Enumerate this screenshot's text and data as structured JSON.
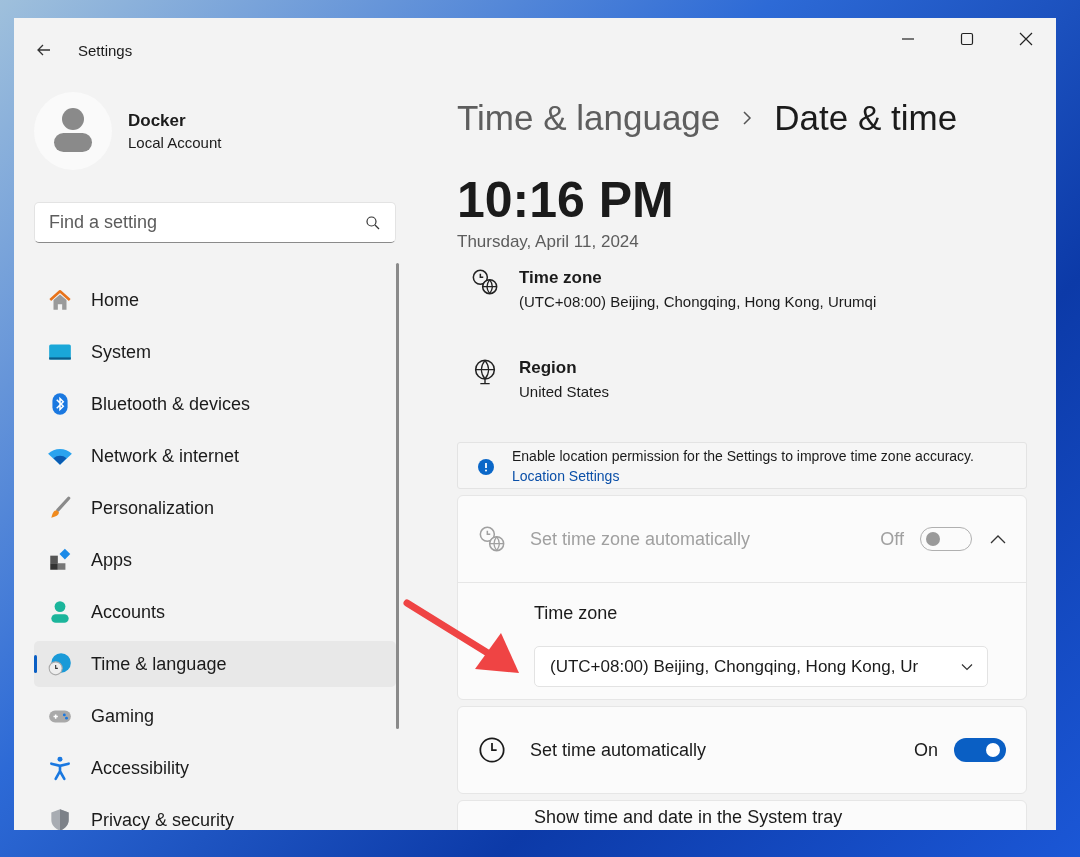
{
  "window": {
    "title": "Settings"
  },
  "account": {
    "name": "Docker",
    "type": "Local Account"
  },
  "search": {
    "placeholder": "Find a setting"
  },
  "sidebar": {
    "items": [
      {
        "label": "Home",
        "selected": false
      },
      {
        "label": "System",
        "selected": false
      },
      {
        "label": "Bluetooth & devices",
        "selected": false
      },
      {
        "label": "Network & internet",
        "selected": false
      },
      {
        "label": "Personalization",
        "selected": false
      },
      {
        "label": "Apps",
        "selected": false
      },
      {
        "label": "Accounts",
        "selected": false
      },
      {
        "label": "Time & language",
        "selected": true
      },
      {
        "label": "Gaming",
        "selected": false
      },
      {
        "label": "Accessibility",
        "selected": false
      },
      {
        "label": "Privacy & security",
        "selected": false
      }
    ]
  },
  "breadcrumb": {
    "parent": "Time & language",
    "current": "Date & time"
  },
  "clock": {
    "time": "10:16 PM",
    "date": "Thursday, April 11, 2024"
  },
  "settings": [
    {
      "kind": "info",
      "title": "Time zone",
      "value": "(UTC+08:00) Beijing, Chongqing, Hong Kong, Urumqi"
    },
    {
      "kind": "info",
      "title": "Region",
      "value": "United States"
    },
    {
      "kind": "notice",
      "text": "Enable location permission for the Settings to improve time zone accuracy.",
      "link": "Location Settings"
    },
    {
      "kind": "toggle",
      "label": "Set time zone automatically",
      "state_label": "Off",
      "on": false,
      "disabled": true,
      "expanded": true,
      "sub": {
        "label": "Time zone",
        "value": "(UTC+08:00) Beijing, Chongqing, Hong Kong, Ur"
      }
    },
    {
      "kind": "toggle",
      "label": "Set time automatically",
      "state_label": "On",
      "on": true,
      "disabled": false
    },
    {
      "kind": "partial",
      "label": "Show time and date in the System tray"
    }
  ]
}
